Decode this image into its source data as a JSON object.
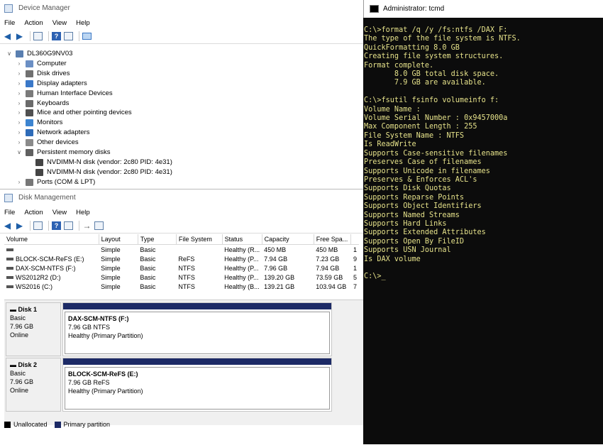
{
  "device_manager": {
    "title": "Device Manager",
    "menu": [
      "File",
      "Action",
      "View",
      "Help"
    ],
    "tree": [
      {
        "label": "DL360G9NV03",
        "level": 0,
        "expanded": true
      },
      {
        "label": "Computer",
        "level": 1
      },
      {
        "label": "Disk drives",
        "level": 1
      },
      {
        "label": "Display adapters",
        "level": 1
      },
      {
        "label": "Human Interface Devices",
        "level": 1
      },
      {
        "label": "Keyboards",
        "level": 1
      },
      {
        "label": "Mice and other pointing devices",
        "level": 1
      },
      {
        "label": "Monitors",
        "level": 1
      },
      {
        "label": "Network adapters",
        "level": 1
      },
      {
        "label": "Other devices",
        "level": 1
      },
      {
        "label": "Persistent memory disks",
        "level": 1,
        "expanded": true
      },
      {
        "label": "NVDIMM-N disk (vendor: 2c80 PID: 4e31)",
        "level": 2
      },
      {
        "label": "NVDIMM-N disk (vendor: 2c80 PID: 4e31)",
        "level": 2
      },
      {
        "label": "Ports (COM & LPT)",
        "level": 1
      }
    ]
  },
  "disk_management": {
    "title": "Disk Management",
    "menu": [
      "File",
      "Action",
      "View",
      "Help"
    ],
    "columns": [
      "Volume",
      "Layout",
      "Type",
      "File System",
      "Status",
      "Capacity",
      "Free Spa..."
    ],
    "rows": [
      [
        "",
        "Simple",
        "Basic",
        "",
        "Healthy (R...",
        "450 MB",
        "450 MB",
        "1"
      ],
      [
        "BLOCK-SCM-ReFS (E:)",
        "Simple",
        "Basic",
        "ReFS",
        "Healthy (P...",
        "7.94 GB",
        "7.23 GB",
        "9"
      ],
      [
        "DAX-SCM-NTFS  (F:)",
        "Simple",
        "Basic",
        "NTFS",
        "Healthy (P...",
        "7.96 GB",
        "7.94 GB",
        "1"
      ],
      [
        "WS2012R2 (D:)",
        "Simple",
        "Basic",
        "NTFS",
        "Healthy (P...",
        "139.20 GB",
        "73.59 GB",
        "5"
      ],
      [
        "WS2016 (C:)",
        "Simple",
        "Basic",
        "NTFS",
        "Healthy (B...",
        "139.21 GB",
        "103.94 GB",
        "7"
      ]
    ],
    "disks": [
      {
        "name": "Disk 1",
        "type": "Basic",
        "size": "7.96 GB",
        "state": "Online",
        "partition": {
          "name": "DAX-SCM-NTFS   (F:)",
          "detail": "7.96 GB NTFS",
          "status": "Healthy (Primary Partition)"
        }
      },
      {
        "name": "Disk 2",
        "type": "Basic",
        "size": "7.96 GB",
        "state": "Online",
        "partition": {
          "name": "BLOCK-SCM-ReFS  (E:)",
          "detail": "7.96 GB ReFS",
          "status": "Healthy (Primary Partition)"
        }
      }
    ],
    "legend": [
      {
        "label": "Unallocated",
        "color": "#000000"
      },
      {
        "label": "Primary partition",
        "color": "#1c2a66"
      }
    ]
  },
  "console": {
    "title": "Administrator: tcmd",
    "lines": [
      "C:\\>format /q /y /fs:ntfs /DAX F:",
      "The type of the file system is NTFS.",
      "QuickFormatting 8.0 GB",
      "Creating file system structures.",
      "Format complete.",
      "       8.0 GB total disk space.",
      "       7.9 GB are available.",
      "",
      "C:\\>fsutil fsinfo volumeinfo f:",
      "Volume Name :",
      "Volume Serial Number : 0x9457000a",
      "Max Component Length : 255",
      "File System Name : NTFS",
      "Is ReadWrite",
      "Supports Case-sensitive filenames",
      "Preserves Case of filenames",
      "Supports Unicode in filenames",
      "Preserves & Enforces ACL's",
      "Supports Disk Quotas",
      "Supports Reparse Points",
      "Supports Object Identifiers",
      "Supports Named Streams",
      "Supports Hard Links",
      "Supports Extended Attributes",
      "Supports Open By FileID",
      "Supports USN Journal",
      "Is DAX volume",
      "",
      "C:\\>"
    ],
    "text_color": "#e6e28a"
  }
}
